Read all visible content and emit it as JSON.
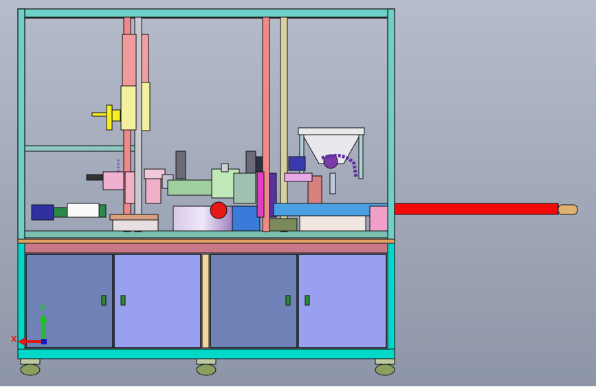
{
  "colors": {
    "background_top": "#b6bcca",
    "background_bottom": "#8d95a8",
    "frame_outline": "#111111",
    "frame_cyan": "#00d8c8",
    "frame_green": "#2fb070",
    "cabinet_panel_dark": "#6e82b8",
    "cabinet_panel_light": "#9aa0f0",
    "cabinet_header_pink": "#c9788a",
    "cabinet_header_orange": "#e0a060",
    "cabinet_center_post": "#f0d8a0",
    "handle_green": "#2e8a2e",
    "red_column": "#f08a8a",
    "yellow_handwheel": "#f5f020",
    "conveyor_blue": "#4aa0e0",
    "output_conveyor_red": "#f20a0a",
    "output_conveyor_tan": "#e0b070",
    "purple_turntable": "#a060c0",
    "hopper_gray": "#d0d0d8",
    "motor_magenta": "#e040c0",
    "axis_x": "#e01818",
    "axis_y": "#20c020"
  },
  "axis_triad": {
    "x_label": "X",
    "y_label": "Y"
  },
  "icons": {
    "triad": "xyz-axis-triad-icon",
    "door_handle": "cabinet-handle-icon",
    "caster": "caster-wheel-icon"
  }
}
